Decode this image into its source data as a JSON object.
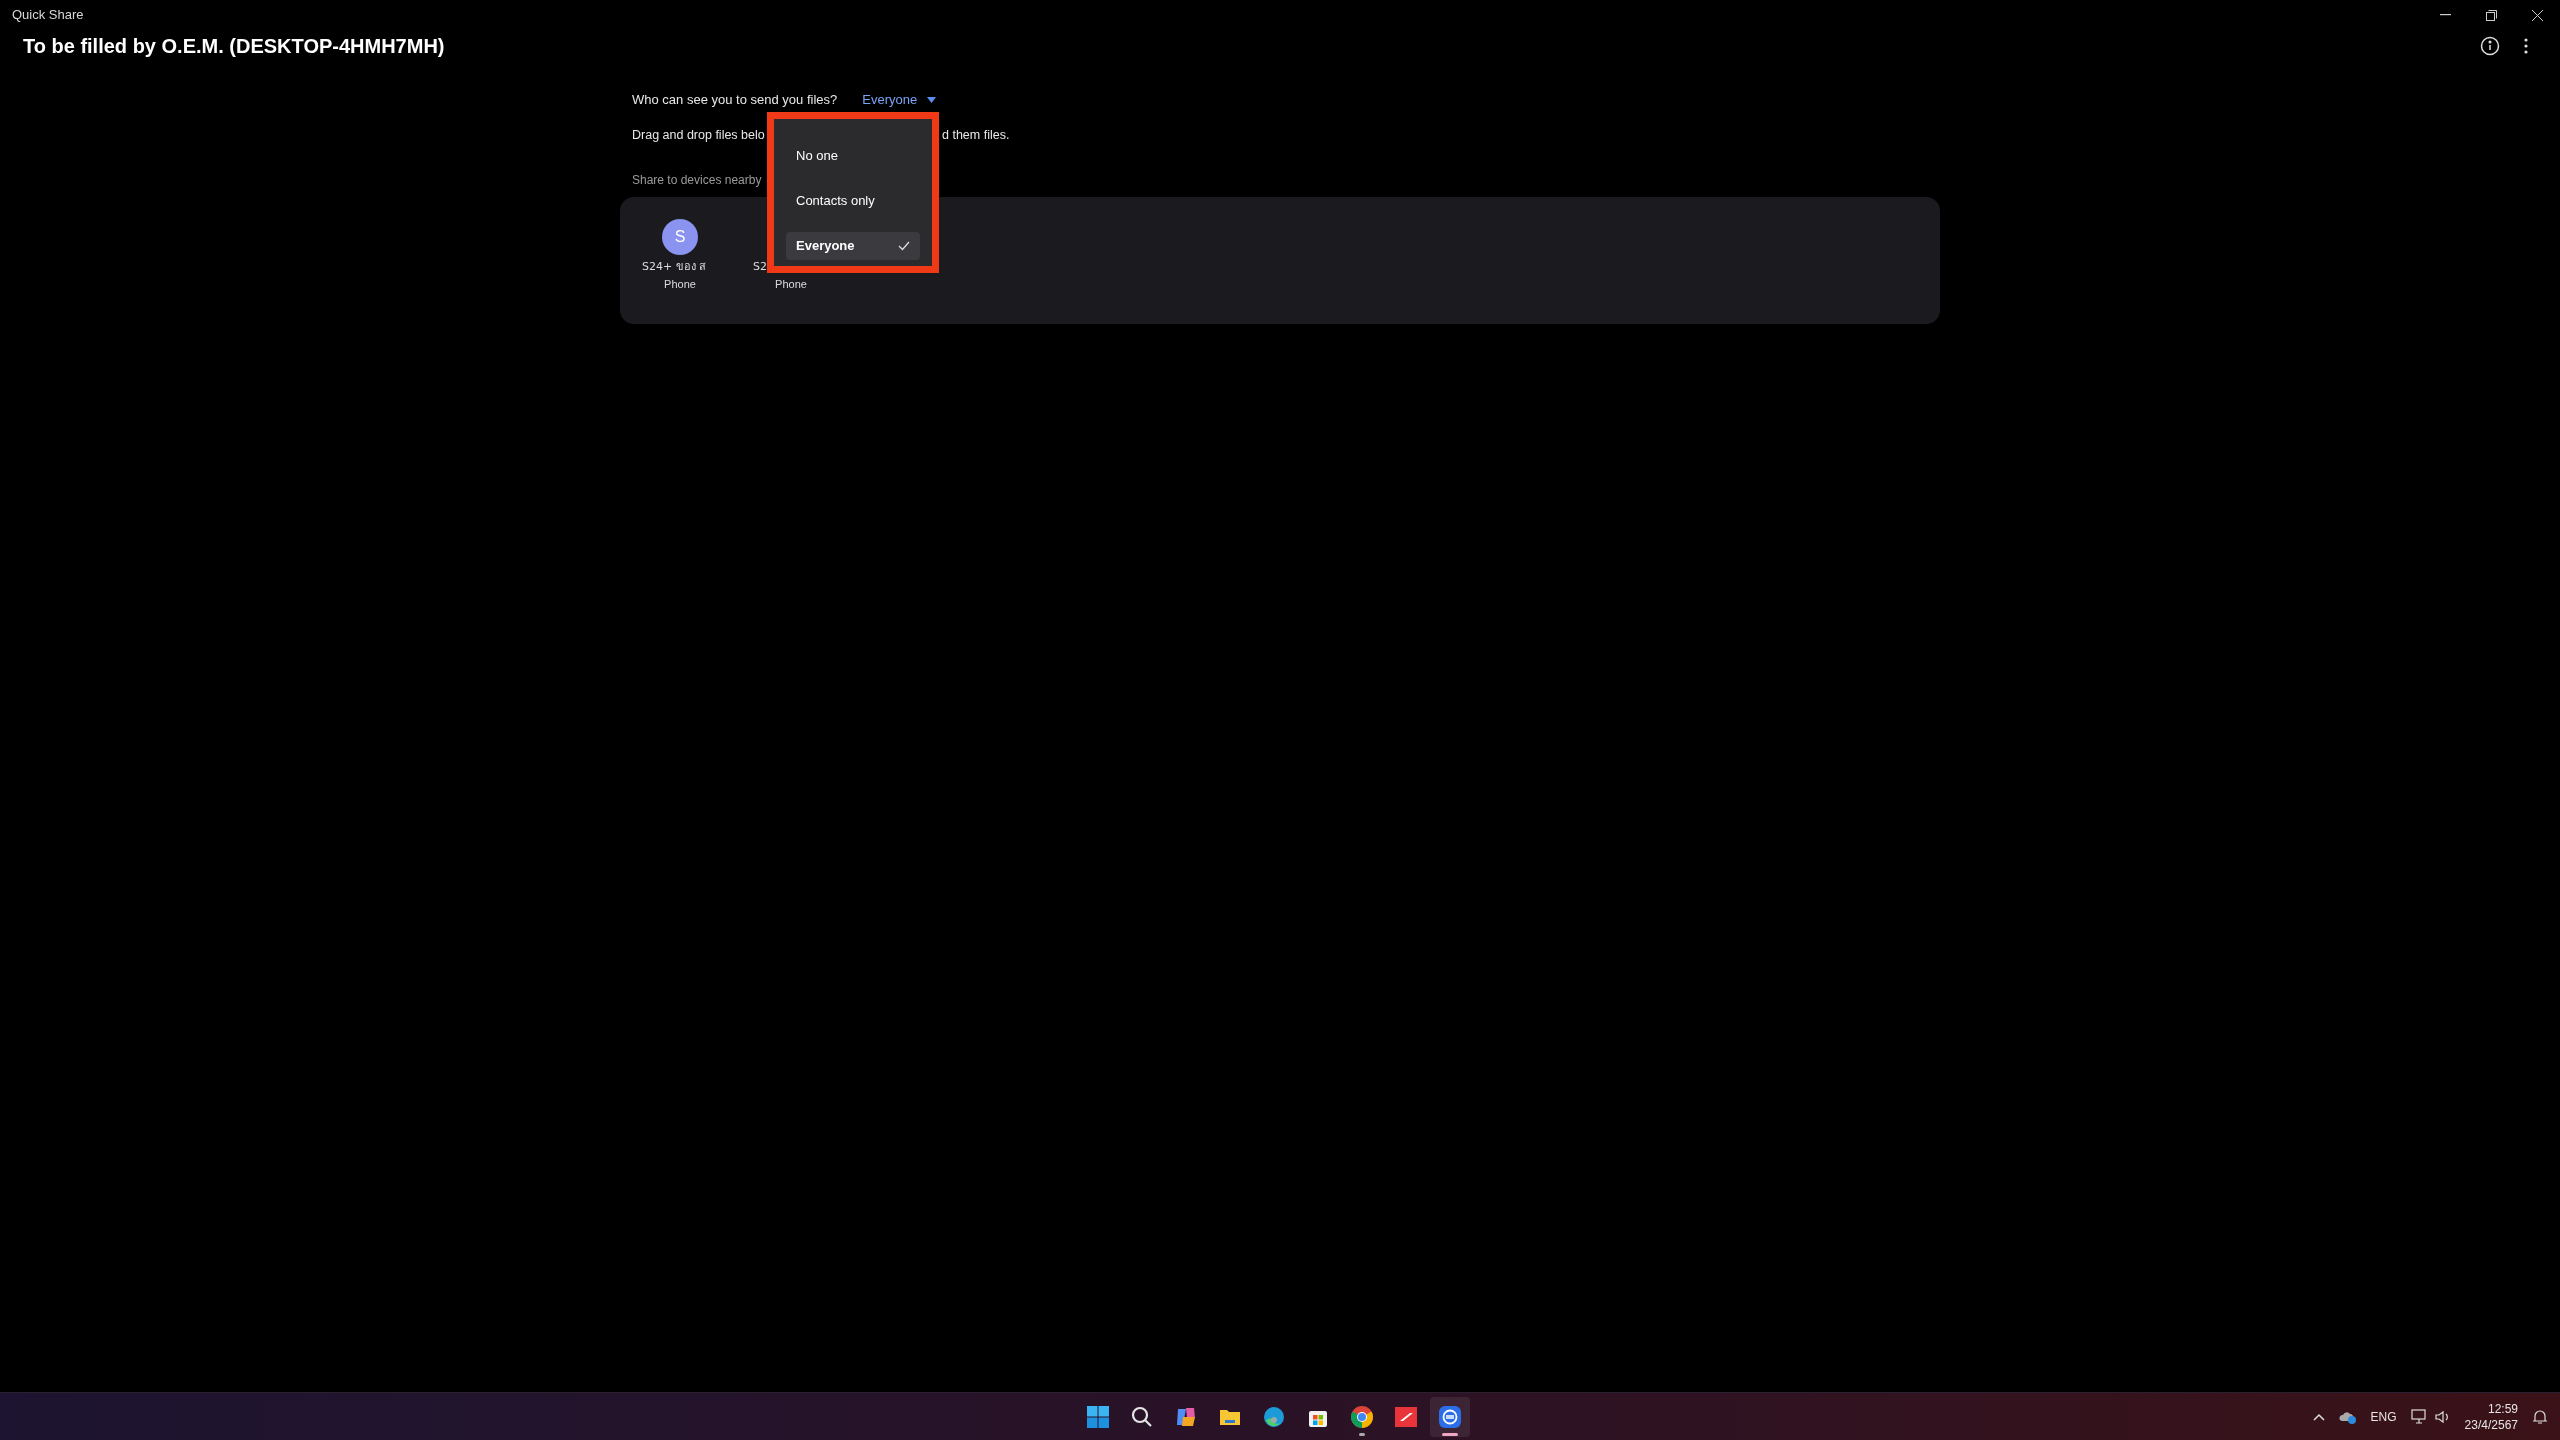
{
  "window": {
    "title": "Quick Share"
  },
  "header": {
    "title": "To be filled by O.E.M. (DESKTOP-4HMH7MH)"
  },
  "visibility": {
    "label": "Who can see you to send you files?",
    "value": "Everyone",
    "menu": {
      "expanded": true,
      "options": [
        {
          "label": "No one",
          "selected": false
        },
        {
          "label": "Contacts only",
          "selected": false
        },
        {
          "label": "Everyone",
          "selected": true
        }
      ]
    }
  },
  "instructions": [
    "Drag and drop files belo",
    "d them files."
  ],
  "nearby": {
    "heading": "Share to devices nearby",
    "devices": [
      {
        "avatar": "S",
        "name": "S24+ ของ ส",
        "type": "Phone"
      },
      {
        "name": "S2",
        "type": "Phone"
      }
    ]
  },
  "taskbar": {
    "apps": [
      {
        "kind": "start",
        "running": false,
        "active": false
      },
      {
        "kind": "search",
        "running": false,
        "active": false
      },
      {
        "kind": "copilot",
        "running": false,
        "active": false
      },
      {
        "kind": "folder",
        "running": false,
        "active": false
      },
      {
        "kind": "edge",
        "running": false,
        "active": false
      },
      {
        "kind": "store",
        "running": false,
        "active": false
      },
      {
        "kind": "chrome",
        "running": true,
        "active": false
      },
      {
        "kind": "game",
        "running": false,
        "active": false
      },
      {
        "kind": "share",
        "running": true,
        "active": true
      }
    ],
    "tray": {
      "language": "ENG",
      "time": "12:59",
      "date": "23/4/2567"
    }
  }
}
